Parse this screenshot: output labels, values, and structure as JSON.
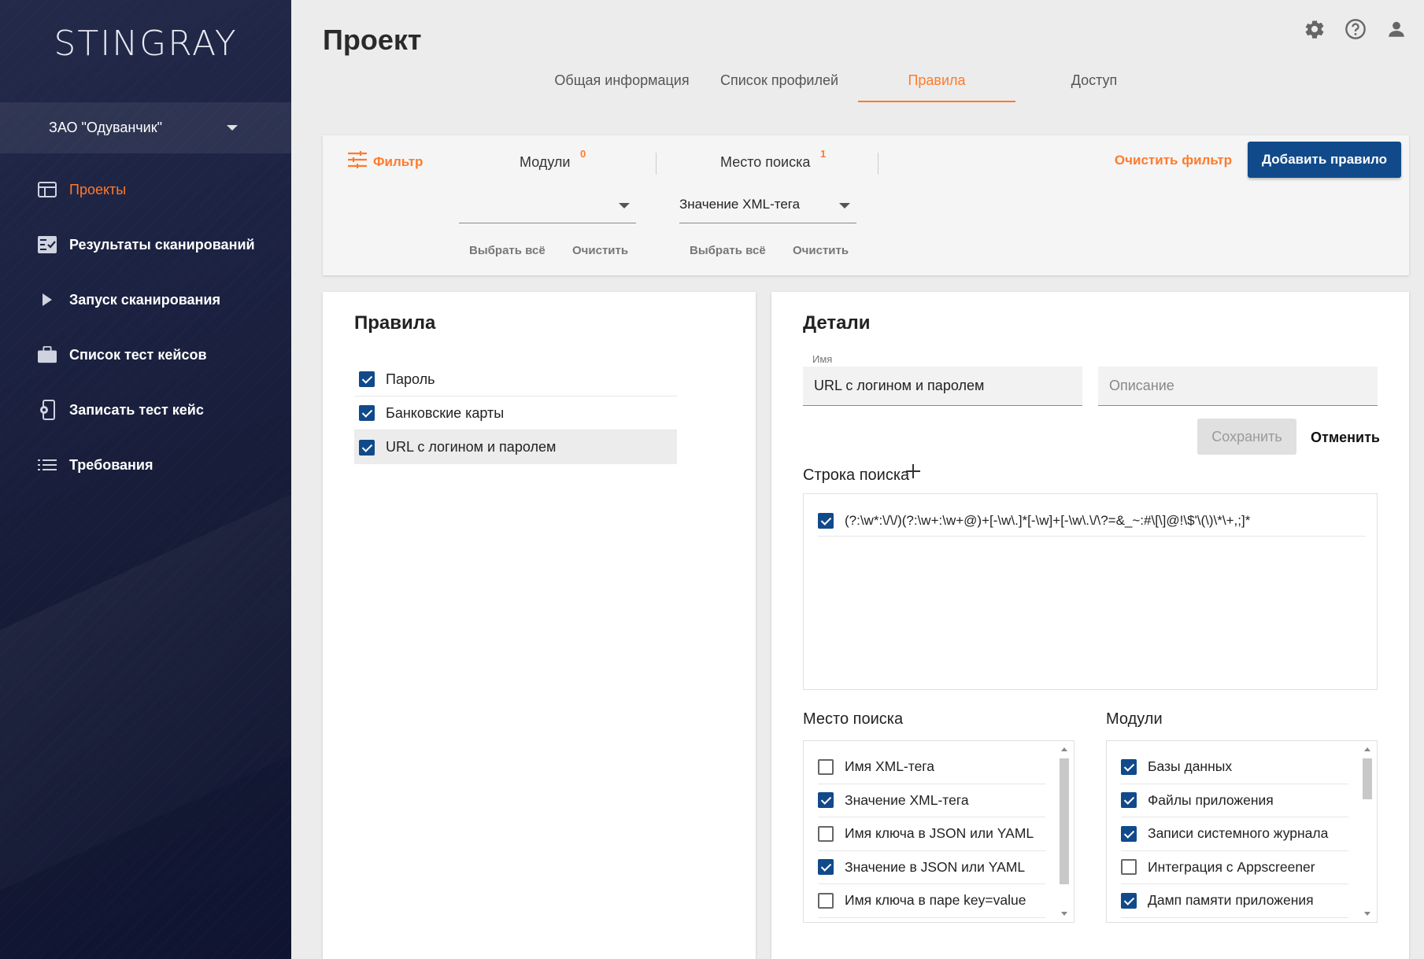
{
  "app": {
    "logo": "STINGRAY"
  },
  "sidebar": {
    "org": "ЗАО \"Одуванчик\"",
    "items": [
      {
        "label": "Проекты",
        "icon": "projects-icon",
        "active": true
      },
      {
        "label": "Результаты сканирований",
        "icon": "scan-results-icon",
        "active": false
      },
      {
        "label": "Запуск сканирования",
        "icon": "play-icon",
        "active": false
      },
      {
        "label": "Список тест кейсов",
        "icon": "briefcase-icon",
        "active": false
      },
      {
        "label": "Записать тест кейс",
        "icon": "record-device-icon",
        "active": false
      },
      {
        "label": "Требования",
        "icon": "list-icon",
        "active": false
      }
    ]
  },
  "header": {
    "title": "Проект",
    "tabs": [
      {
        "label": "Общая информация"
      },
      {
        "label": "Список профилей"
      },
      {
        "label": "Правила",
        "active": true
      },
      {
        "label": "Доступ"
      }
    ]
  },
  "filter": {
    "label": "Фильтр",
    "modules": {
      "title": "Модули",
      "count": "0",
      "value": "",
      "select_all": "Выбрать всё",
      "clear": "Очистить"
    },
    "location": {
      "title": "Место поиска",
      "count": "1",
      "value": "Значение XML-тега",
      "select_all": "Выбрать всё",
      "clear": "Очистить"
    },
    "clear_filter": "Очистить фильтр",
    "add_rule": "Добавить правило"
  },
  "rules": {
    "title": "Правила",
    "items": [
      {
        "label": "Пароль",
        "checked": true
      },
      {
        "label": "Банковские карты",
        "checked": true
      },
      {
        "label": "URL с логином и паролем",
        "checked": true,
        "selected": true
      }
    ]
  },
  "details": {
    "title": "Детали",
    "name_label": "Имя",
    "name_value": "URL с логином и паролем",
    "description_placeholder": "Описание",
    "save": "Сохранить",
    "cancel": "Отменить",
    "search_string_title": "Строка поиска",
    "search_strings": [
      {
        "value": "(?:\\w*:\\/\\/)(?:\\w+:\\w+@)+[-\\w\\.]*[-\\w]+[-\\w\\.\\/\\?=&_~:#\\[\\]@!\\$'\\(\\)\\*\\+,;]*",
        "checked": true
      }
    ],
    "location_title": "Место поиска",
    "locations": [
      {
        "label": "Имя XML-тега",
        "checked": false
      },
      {
        "label": "Значение XML-тега",
        "checked": true
      },
      {
        "label": "Имя ключа в JSON или YAML",
        "checked": false
      },
      {
        "label": "Значение в JSON или YAML",
        "checked": true
      },
      {
        "label": "Имя ключа в паре key=value",
        "checked": false
      }
    ],
    "modules_title": "Модули",
    "modules": [
      {
        "label": "Базы данных",
        "checked": true
      },
      {
        "label": "Файлы приложения",
        "checked": true
      },
      {
        "label": "Записи системного журнала",
        "checked": true
      },
      {
        "label": "Интеграция с Appscreener",
        "checked": false
      },
      {
        "label": "Дамп памяти приложения",
        "checked": true
      }
    ]
  },
  "colors": {
    "accent": "#ff7a2b",
    "primary": "#114a8a",
    "sidebar": "#1b2140"
  }
}
